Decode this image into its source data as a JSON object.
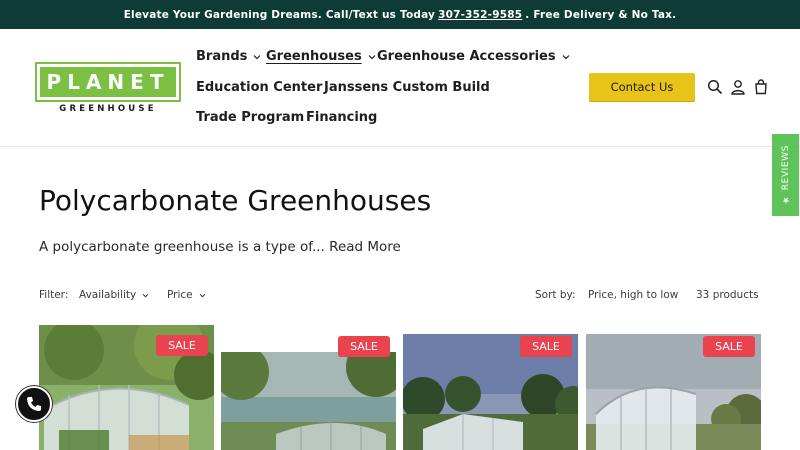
{
  "announcement": {
    "before": "Elevate Your Gardening Dreams. Call/Text us Today",
    "phone": "307-352-9585",
    "after": ". Free Delivery & No Tax."
  },
  "logo": {
    "main": "PLANET",
    "sub": "GREENHOUSE"
  },
  "nav": {
    "brands": "Brands",
    "greenhouses": "Greenhouses",
    "accessories": "Greenhouse Accessories",
    "education": "Education Center",
    "custom": "Janssens Custom Build",
    "trade": "Trade Program",
    "financing": "Financing"
  },
  "header": {
    "contact": "Contact Us",
    "icons": [
      "search-icon",
      "account-icon",
      "cart-icon"
    ]
  },
  "reviews_tab": "★ REVIEWS",
  "collection": {
    "title": "Polycarbonate Greenhouses",
    "intro": "A polycarbonate greenhouse is a type of...",
    "read_more": "Read More"
  },
  "filters": {
    "label": "Filter:",
    "availability": "Availability",
    "price": "Price",
    "sort_label": "Sort by:",
    "sort_value": "Price, high to low",
    "count": "33 products"
  },
  "products": [
    {
      "badge": "SALE",
      "image": "greenhouse-photo-1"
    },
    {
      "badge": "SALE",
      "image": "greenhouse-photo-2"
    },
    {
      "badge": "SALE",
      "image": "greenhouse-photo-3"
    },
    {
      "badge": "SALE",
      "image": "greenhouse-photo-4"
    }
  ],
  "colors": {
    "announcement_bg": "#0f3b36",
    "brand_green": "#7bc043",
    "button_yellow": "#e8c318",
    "sale_red": "#e8434e",
    "reviews_green": "#5ec35b"
  },
  "chat_icon": "phone-chat-icon"
}
